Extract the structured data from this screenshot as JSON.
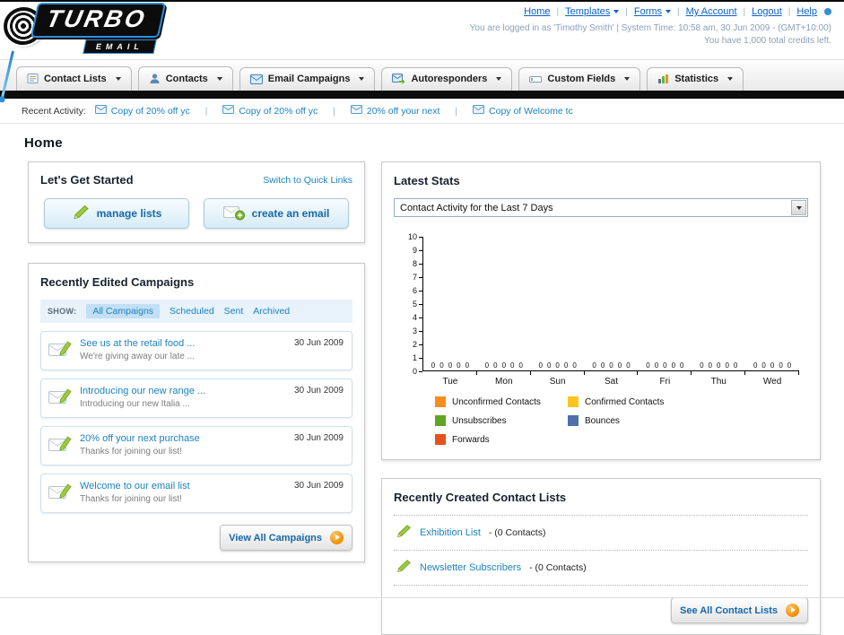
{
  "header": {
    "logo": {
      "title": "TURBO",
      "subtitle": "EMAIL"
    },
    "nav": [
      "Home",
      "Templates",
      "Forms",
      "My Account",
      "Logout",
      "Help"
    ],
    "session_line": "You are logged in as 'Timothy Smith' | System Time: 10:58 am, 30 Jun 2009 - (GMT+10:00)",
    "credits_line": "You have 1,000 total credits left."
  },
  "main_nav": {
    "tabs": [
      {
        "label": "Contact Lists",
        "icon": "contact-lists-icon"
      },
      {
        "label": "Contacts",
        "icon": "contacts-icon"
      },
      {
        "label": "Email Campaigns",
        "icon": "email-campaigns-icon"
      },
      {
        "label": "Autoresponders",
        "icon": "autoresponders-icon"
      },
      {
        "label": "Custom Fields",
        "icon": "custom-fields-icon"
      },
      {
        "label": "Statistics",
        "icon": "statistics-icon"
      }
    ]
  },
  "recent_activity": {
    "label": "Recent Activity:",
    "items": [
      "Copy of 20% off yc",
      "Copy of 20% off yc",
      "20% off your next",
      "Copy of Welcome tc"
    ]
  },
  "page_title": "Home",
  "get_started": {
    "title": "Let's Get Started",
    "switch_link": "Switch to Quick Links",
    "manage_lists_label": "manage lists",
    "create_email_label": "create an email"
  },
  "campaigns": {
    "title": "Recently Edited Campaigns",
    "show_label": "SHOW:",
    "filters": [
      "All Campaigns",
      "Scheduled",
      "Sent",
      "Archived"
    ],
    "items": [
      {
        "title": "See us at the retail food ...",
        "subtitle": "We're giving away our late ...",
        "date": "30 Jun 2009"
      },
      {
        "title": "Introducing our new range ...",
        "subtitle": "Introducing our new Italia ...",
        "date": "30 Jun 2009"
      },
      {
        "title": "20% off your next purchase",
        "subtitle": "Thanks for joining our list!",
        "date": "30 Jun 2009"
      },
      {
        "title": "Welcome to our email list",
        "subtitle": "Thanks for joining our list!",
        "date": "30 Jun 2009"
      }
    ],
    "view_all_label": "View All Campaigns"
  },
  "stats": {
    "title": "Latest Stats",
    "dropdown_value": "Contact Activity for the Last 7 Days"
  },
  "chart_data": {
    "type": "bar",
    "title": "Contact Activity for the Last 7 Days",
    "categories": [
      "Tue",
      "Mon",
      "Sun",
      "Sat",
      "Fri",
      "Thu",
      "Wed"
    ],
    "series": [
      {
        "name": "Unconfirmed Contacts",
        "color": "#f88c1d",
        "values": [
          0,
          0,
          0,
          0,
          0,
          0,
          0
        ]
      },
      {
        "name": "Confirmed Contacts",
        "color": "#fdc420",
        "values": [
          0,
          0,
          0,
          0,
          0,
          0,
          0
        ]
      },
      {
        "name": "Unsubscribes",
        "color": "#61a424",
        "values": [
          0,
          0,
          0,
          0,
          0,
          0,
          0
        ]
      },
      {
        "name": "Bounces",
        "color": "#4f6eaa",
        "values": [
          0,
          0,
          0,
          0,
          0,
          0,
          0
        ]
      },
      {
        "name": "Forwards",
        "color": "#e6511f",
        "values": [
          0,
          0,
          0,
          0,
          0,
          0,
          0
        ]
      }
    ],
    "ylim": [
      0,
      10
    ],
    "ytick_step": 1,
    "grid": false,
    "legend_position": "bottom"
  },
  "contact_lists": {
    "title": "Recently Created Contact Lists",
    "items": [
      {
        "name": "Exhibition List",
        "suffix": "- (0 Contacts)"
      },
      {
        "name": "Newsletter Subscribers",
        "suffix": "- (0 Contacts)"
      }
    ],
    "see_all_label": "See All Contact Lists"
  }
}
